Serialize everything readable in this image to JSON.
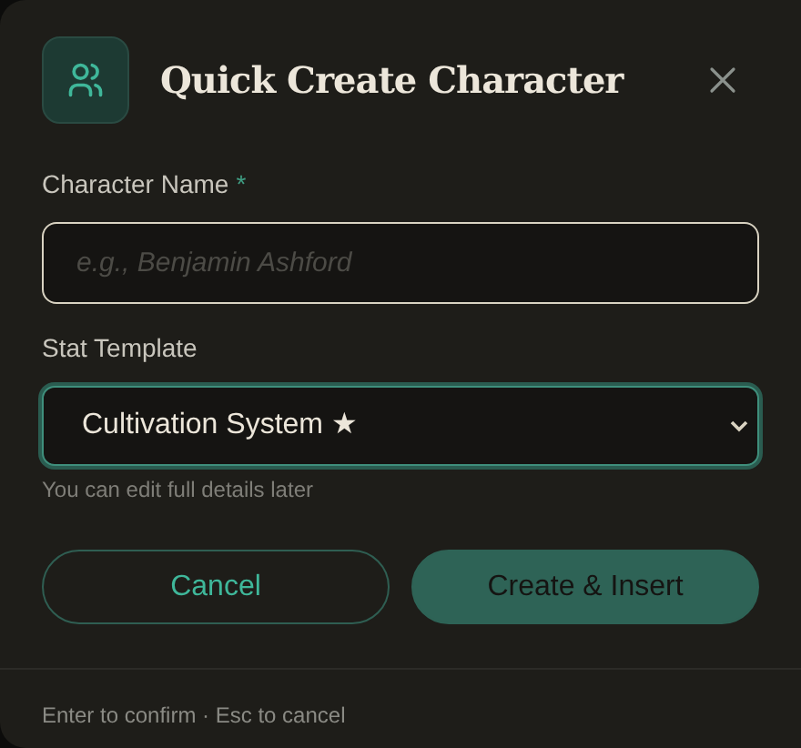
{
  "dialog": {
    "title": "Quick Create Character"
  },
  "fields": [
    {
      "kind": "text",
      "label": "Character Name",
      "required_mark": "*",
      "placeholder": "e.g., Benjamin Ashford",
      "focused": false
    },
    {
      "kind": "select",
      "label": "Stat Template",
      "value": "Cultivation System ★",
      "focused": true,
      "hint": "You can edit full details later"
    }
  ],
  "buttons": [
    {
      "label": "Cancel",
      "kind": "secondary"
    },
    {
      "label": "Create & Insert",
      "kind": "primary"
    }
  ],
  "footer": "Enter to confirm · Esc to cancel"
}
